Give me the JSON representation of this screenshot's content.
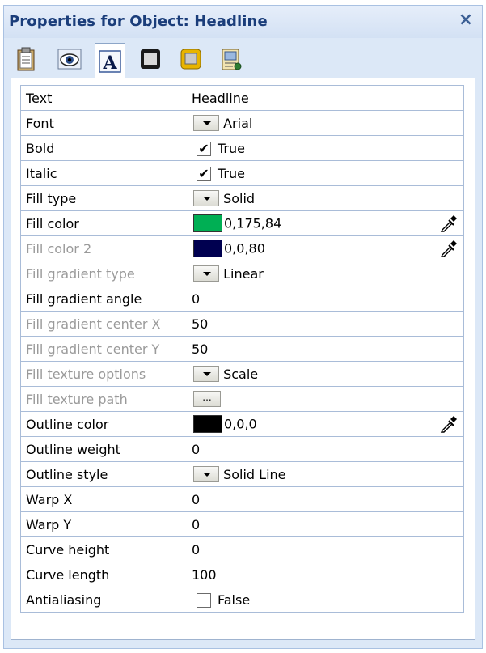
{
  "window": {
    "title": "Properties for Object: Headline",
    "close_symbol": "×"
  },
  "toolbar": {
    "tabs": [
      {
        "icon": "clipboard-icon"
      },
      {
        "icon": "eye-icon"
      },
      {
        "icon": "text-a-icon",
        "active": true
      },
      {
        "icon": "frame-icon"
      },
      {
        "icon": "shadow-box-icon"
      },
      {
        "icon": "document-properties-icon"
      }
    ]
  },
  "properties": {
    "text": {
      "label": "Text",
      "value": "Headline"
    },
    "font": {
      "label": "Font",
      "value": "Arial"
    },
    "bold": {
      "label": "Bold",
      "value": "True",
      "checked": true
    },
    "italic": {
      "label": "Italic",
      "value": "True",
      "checked": true
    },
    "fill_type": {
      "label": "Fill type",
      "value": "Solid"
    },
    "fill_color": {
      "label": "Fill color",
      "value": "0,175,84",
      "swatch": "#00af54"
    },
    "fill_color2": {
      "label": "Fill color 2",
      "value": "0,0,80",
      "swatch": "#000050"
    },
    "grad_type": {
      "label": "Fill gradient type",
      "value": "Linear"
    },
    "grad_angle": {
      "label": "Fill gradient angle",
      "value": "0"
    },
    "grad_cx": {
      "label": "Fill gradient center X",
      "value": "50"
    },
    "grad_cy": {
      "label": "Fill gradient center Y",
      "value": "50"
    },
    "tex_opts": {
      "label": "Fill texture options",
      "value": "Scale"
    },
    "tex_path": {
      "label": "Fill texture path",
      "button": "..."
    },
    "outline_color": {
      "label": "Outline color",
      "value": "0,0,0",
      "swatch": "#000000"
    },
    "outline_weight": {
      "label": "Outline weight",
      "value": "0"
    },
    "outline_style": {
      "label": "Outline style",
      "value": "Solid Line"
    },
    "warp_x": {
      "label": "Warp X",
      "value": "0"
    },
    "warp_y": {
      "label": "Warp Y",
      "value": "0"
    },
    "curve_height": {
      "label": "Curve height",
      "value": "0"
    },
    "curve_length": {
      "label": "Curve length",
      "value": "100"
    },
    "antialiasing": {
      "label": "Antialiasing",
      "value": "False",
      "checked": false
    }
  }
}
